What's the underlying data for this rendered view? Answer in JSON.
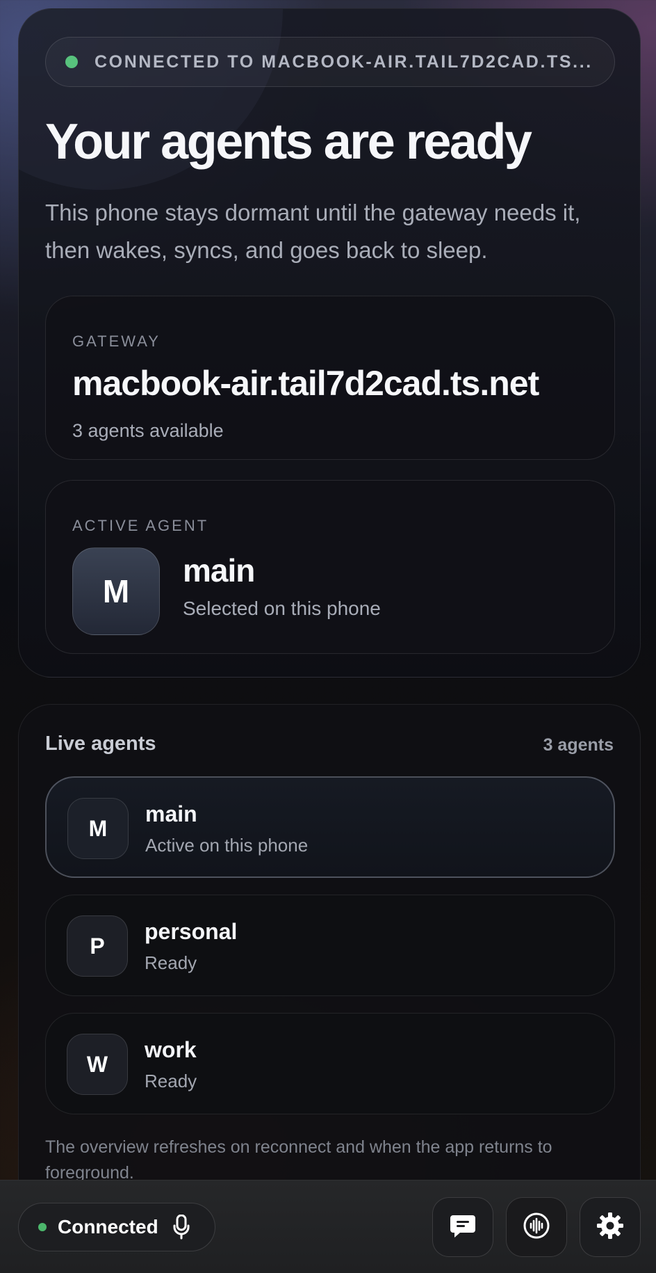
{
  "hero": {
    "connection_text": "CONNECTED TO MACBOOK-AIR.TAIL7D2CAD.TS...",
    "title": "Your agents are ready",
    "subtitle": "This phone stays dormant until the gateway needs it, then wakes, syncs, and goes back to sleep."
  },
  "gateway": {
    "label": "GATEWAY",
    "host": "macbook-air.tail7d2cad.ts.net",
    "agents_available": "3 agents available"
  },
  "active_agent": {
    "label": "ACTIVE AGENT",
    "initial": "M",
    "name": "main",
    "status": "Selected on this phone"
  },
  "live_agents": {
    "title": "Live agents",
    "count": "3 agents",
    "items": [
      {
        "initial": "M",
        "name": "main",
        "status": "Active on this phone"
      },
      {
        "initial": "P",
        "name": "personal",
        "status": "Ready"
      },
      {
        "initial": "W",
        "name": "work",
        "status": "Ready"
      }
    ],
    "footnote": "The overview refreshes on reconnect and when the app returns to foreground."
  },
  "bottom_bar": {
    "status_label": "Connected",
    "icons": [
      "microphone-icon",
      "chat-icon",
      "voice-waveform-icon",
      "gear-icon"
    ]
  },
  "colors": {
    "status_green": "#58c27d",
    "accent_text": "#f6f7fa",
    "muted_text": "#a9adb8"
  }
}
